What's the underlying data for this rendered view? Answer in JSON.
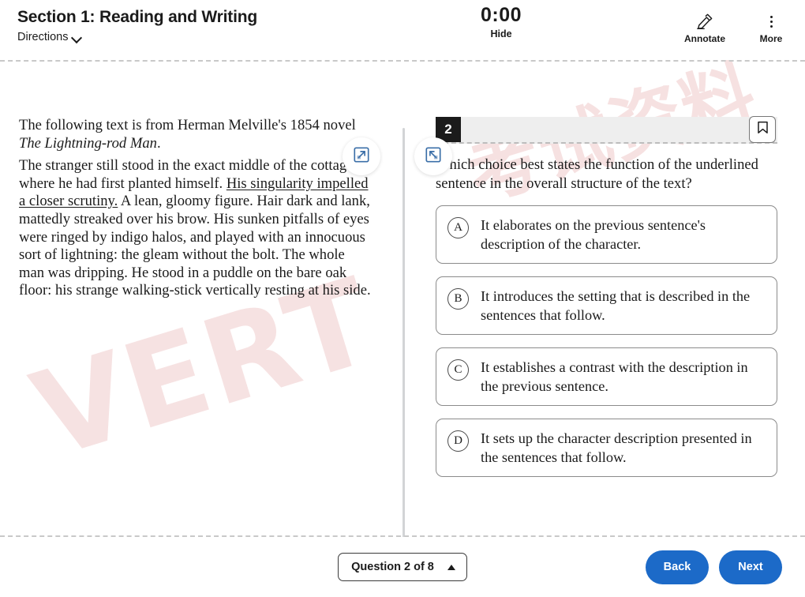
{
  "header": {
    "section_title": "Section 1: Reading and Writing",
    "directions_label": "Directions",
    "directions_icon": "chevron-down-icon",
    "timer": {
      "value": "0:00",
      "hide_label": "Hide"
    },
    "tools": [
      {
        "id": "annotate",
        "label": "Annotate",
        "icon": "highlighter-pen-icon"
      },
      {
        "id": "more",
        "label": "More",
        "icon": "vertical-ellipsis-icon"
      }
    ]
  },
  "panes": {
    "expand_left_icon": "expand-arrow-icon",
    "expand_right_icon": "collapse-arrow-icon",
    "divider_icon": "pane-divider-handle"
  },
  "passage": {
    "intro_before": "The following text is from Herman Melville's 1854 novel ",
    "intro_title": "The Lightning-rod Man",
    "intro_after": ".",
    "body_part1": "The stranger still stood in the exact middle of the cottage, where he had first planted himself. ",
    "body_underlined": "His singularity impelled a closer scrutiny.",
    "body_part2": " A lean, gloomy figure. Hair dark and lank, mattedly streaked over his brow. His sunken pitfalls of eyes were ringed by indigo halos, and played with an innocuous sort of lightning: the gleam without the bolt. The whole man was dripping. He stood in a puddle on the bare oak floor: his strange walking-stick vertically resting at his side."
  },
  "question": {
    "number": "2",
    "bookmark_icon": "bookmark-icon",
    "stem": "Which choice best states the function of the underlined sentence in the overall structure of the text?",
    "choices": [
      {
        "letter": "A",
        "text": "It elaborates on the previous sentence's description of the character."
      },
      {
        "letter": "B",
        "text": "It introduces the setting that is described in the sentences that follow."
      },
      {
        "letter": "C",
        "text": "It establishes a contrast with the description in the previous sentence."
      },
      {
        "letter": "D",
        "text": "It sets up the character description presented in the sentences that follow."
      }
    ]
  },
  "footer": {
    "question_nav_label": "Question 2 of 8",
    "question_nav_icon": "caret-up-icon",
    "back_label": "Back",
    "next_label": "Next"
  },
  "watermark": {
    "line_a": "考试资料",
    "line_b": "VERT"
  },
  "colors": {
    "accent_blue": "#1c6ac8",
    "badge_black": "#1b1b1b",
    "header_bar_gray": "#eeeeee",
    "watermark_pink": "#e9b3b3"
  }
}
